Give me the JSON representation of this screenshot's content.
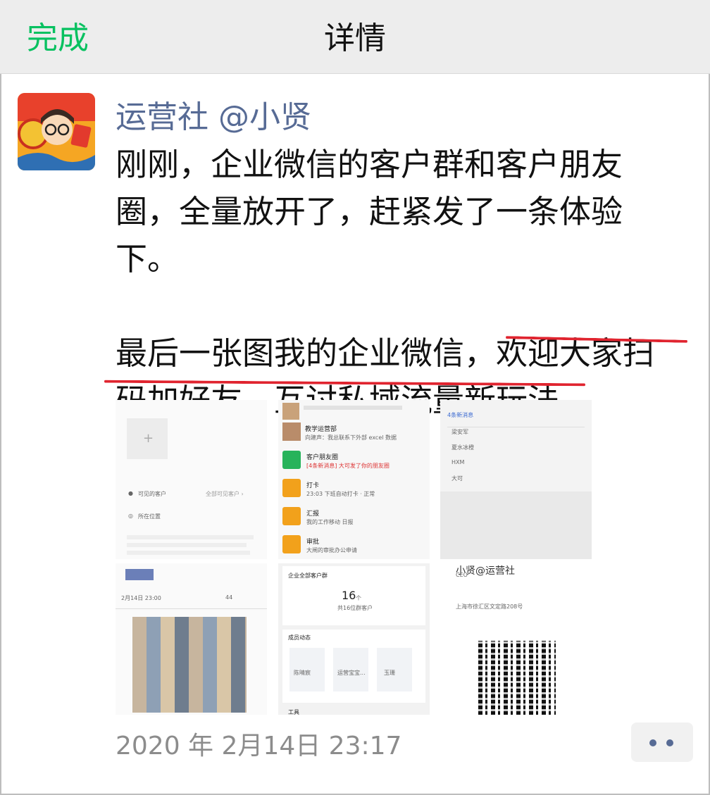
{
  "topbar": {
    "done_label": "完成",
    "title": "详情"
  },
  "post": {
    "author": "运营社 @小贤",
    "text": {
      "para1": [
        "刚刚，企业微信的客户群和客户朋友",
        "圈，全量放开了，赶紧发了一条体验",
        "下。"
      ],
      "para2_line1_plain": "最后一张图我的企业微信，",
      "para2_line1_underlined": "欢迎大家扫",
      "para2_line2": "码加好友，互讨私域流量新玩法",
      "para2_line2_tail": "。"
    },
    "underline_color": "#e0242f",
    "timestamp": "2020 年 2月14日 23:17"
  },
  "images": {
    "img1": {
      "visible_label": "可见的客户",
      "visible_value": "全部可见客户 ›",
      "location_label": "所在位置",
      "date": "2月14日 23:00",
      "likes": "44"
    },
    "img2": {
      "rows": [
        {
          "title": "教学运营部",
          "sub": "向建声：我总联系下外部 excel 数据"
        },
        {
          "title": "客户朋友圈",
          "sub": "[4条新消息] 大可发了你的朋友圈"
        },
        {
          "title": "打卡",
          "sub": "23:03 下班自动打卡 · 正常"
        },
        {
          "title": "汇报",
          "sub": "我的工作移动 日报"
        },
        {
          "title": "审批",
          "sub": "大闸的审批办公申请"
        }
      ]
    },
    "img3": {
      "header": "4条新消息",
      "items": [
        "梁安军",
        "夏水冰橙",
        "HXM",
        "大可"
      ]
    },
    "img5": {
      "card_title": "企业全部客户群",
      "count": "16",
      "count_unit": "个",
      "count_sub": "共16位群客户",
      "section": "成员动态",
      "members": [
        "陈晴宸",
        "运营宝宝...",
        "玉珊"
      ],
      "tools": "工具"
    },
    "img6": {
      "name": "小贤@运营社",
      "role": "CEO",
      "address": "上海市徐汇区文定路208号"
    }
  },
  "colors": {
    "accent_green": "#07c160",
    "link_blue": "#576b95"
  }
}
